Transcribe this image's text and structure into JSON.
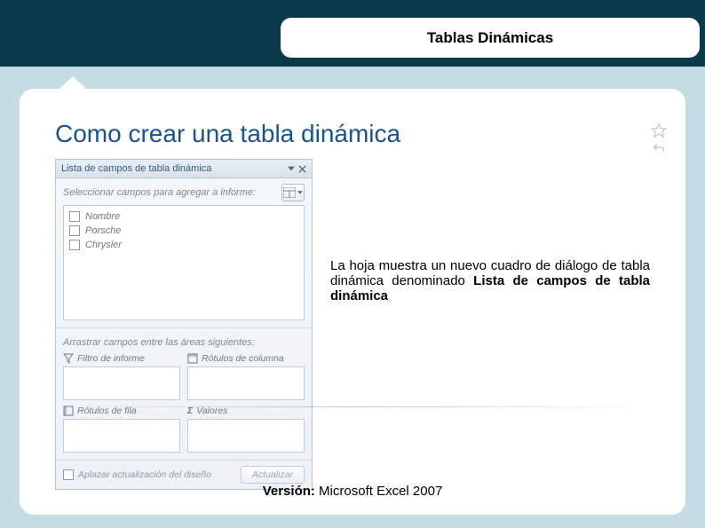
{
  "header": {
    "title": "Tablas Dinámicas"
  },
  "page": {
    "title": "Como crear una tabla dinámica"
  },
  "panel": {
    "title": "Lista de campos de tabla dinámica",
    "select_label": "Seleccionar campos para agregar a informe:",
    "fields": [
      "Nombre",
      "Porsche",
      "Chrysler"
    ],
    "drag_label": "Arrastrar campos entre las áreas siguientes:",
    "areas": {
      "filter": "Filtro de informe",
      "columns": "Rótulos de columna",
      "rows": "Rótulos de fila",
      "values": "Valores"
    },
    "defer_label": "Aplazar actualización del diseño",
    "update_button": "Actualizar"
  },
  "description": {
    "text_before": "La hoja muestra un nuevo cuadro de diálogo de tabla dinámica denominado ",
    "bold": "Lista de campos de tabla dinámica"
  },
  "footer": {
    "version_label": "Versión:",
    "version_value": " Microsoft Excel 2007"
  }
}
